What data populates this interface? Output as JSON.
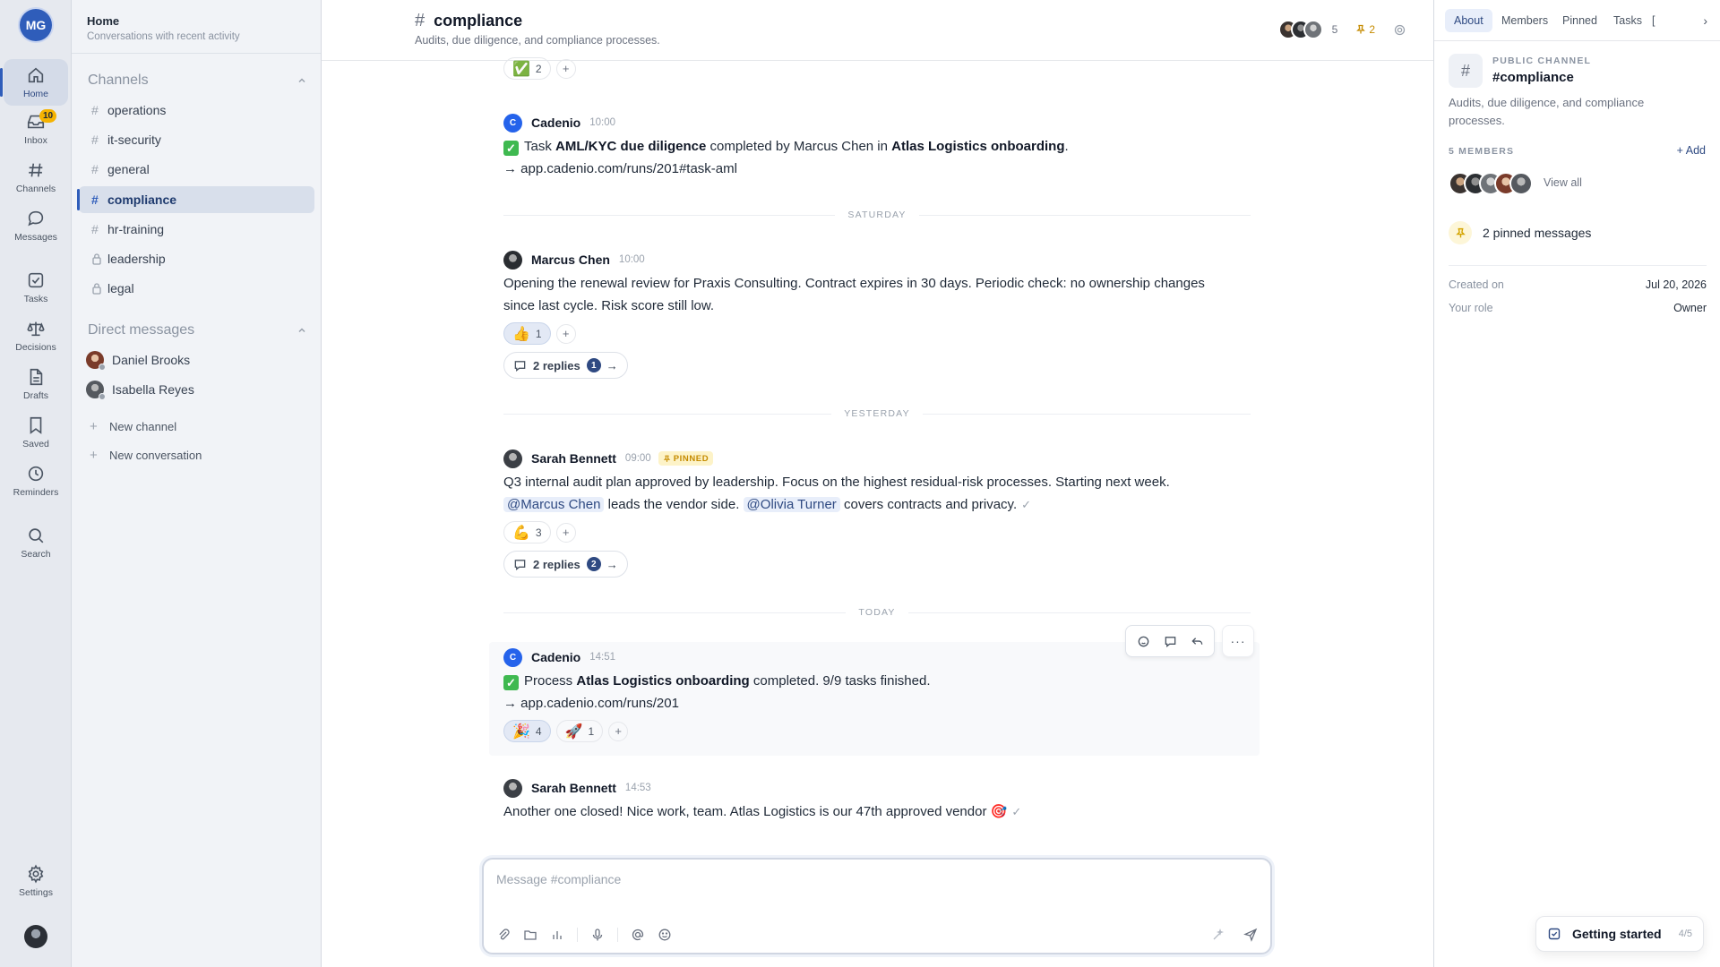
{
  "rail": {
    "user_initials": "MG",
    "items": [
      {
        "label": "Home"
      },
      {
        "label": "Inbox",
        "badge": "10"
      },
      {
        "label": "Channels"
      },
      {
        "label": "Messages"
      },
      {
        "label": "Tasks"
      },
      {
        "label": "Decisions"
      },
      {
        "label": "Drafts"
      },
      {
        "label": "Saved"
      },
      {
        "label": "Reminders"
      },
      {
        "label": "Search"
      },
      {
        "label": "Settings"
      }
    ]
  },
  "sidebar": {
    "title": "Home",
    "subtitle": "Conversations with recent activity",
    "channels_heading": "Channels",
    "channels": [
      {
        "name": "operations",
        "icon": "hash"
      },
      {
        "name": "it-security",
        "icon": "hash"
      },
      {
        "name": "general",
        "icon": "hash"
      },
      {
        "name": "compliance",
        "icon": "hash",
        "active": true
      },
      {
        "name": "hr-training",
        "icon": "hash"
      },
      {
        "name": "leadership",
        "icon": "lock"
      },
      {
        "name": "legal",
        "icon": "lock"
      }
    ],
    "dm_heading": "Direct messages",
    "dms": [
      {
        "name": "Daniel Brooks"
      },
      {
        "name": "Isabella Reyes"
      }
    ],
    "new_channel": "New channel",
    "new_conversation": "New conversation"
  },
  "channel": {
    "name": "compliance",
    "description": "Audits, due diligence, and compliance processes.",
    "member_count": "5",
    "pinned_count": "2"
  },
  "messages": [
    {
      "author": "Cadenio",
      "avatar_letter": "C",
      "time": "10:00",
      "line1": {
        "pre": "Task ",
        "b1": "AML/KYC due diligence",
        "mid": " completed by Marcus Chen in ",
        "b2": "Atlas Logistics onboarding",
        "post": "."
      },
      "line2": "→ app.cadenio.com/runs/201#task-aml"
    },
    {
      "author": "Marcus Chen",
      "time": "10:00",
      "text": "Opening the renewal review for Praxis Consulting. Contract expires in 30 days. Periodic check: no ownership changes since last cycle. Risk score still low.",
      "reaction": {
        "emoji": "👍",
        "count": "1"
      },
      "replies": {
        "label": "2 replies",
        "count": "1"
      }
    },
    {
      "author": "Sarah Bennett",
      "time": "09:00",
      "badge": "PINNED",
      "line1": "Q3 internal audit plan approved by leadership. Focus on the highest residual-risk processes. Starting next week.",
      "mention1": "@Marcus Chen",
      "mid": " leads the vendor side. ",
      "mention2": "@Olivia Turner",
      "post": " covers contracts and privacy.",
      "reaction": {
        "emoji": "💪",
        "count": "3"
      },
      "replies": {
        "label": "2 replies",
        "count": "2"
      }
    },
    {
      "author": "Cadenio",
      "avatar_letter": "C",
      "time": "14:51",
      "line1": {
        "pre": "Process ",
        "b1": "Atlas Logistics onboarding",
        "post": " completed. 9/9 tasks finished."
      },
      "line2": "→ app.cadenio.com/runs/201",
      "reactions": [
        {
          "emoji": "🎉",
          "count": "4"
        },
        {
          "emoji": "🚀",
          "count": "1"
        }
      ]
    },
    {
      "author": "Sarah Bennett",
      "time": "14:53",
      "text": "Another one closed! Nice work, team. Atlas Logistics is our 47th approved vendor 🎯"
    }
  ],
  "top_reaction": {
    "emoji": "✅",
    "count": "2"
  },
  "separators": {
    "saturday": "SATURDAY",
    "yesterday": "YESTERDAY",
    "today": "TODAY"
  },
  "composer": {
    "placeholder": "Message #compliance"
  },
  "right_panel": {
    "tabs": [
      "About",
      "Members",
      "Pinned",
      "Tasks",
      "["
    ],
    "kind": "PUBLIC CHANNEL",
    "name": "#compliance",
    "description": "Audits, due diligence, and compliance processes.",
    "members_heading": "5 MEMBERS",
    "add_label": "+ Add",
    "view_all": "View all",
    "pinned_messages": "2 pinned messages",
    "created_label": "Created on",
    "created_value": "Jul 20, 2026",
    "role_label": "Your role",
    "role_value": "Owner"
  },
  "getting_started": {
    "label": "Getting started",
    "progress": "4/5"
  },
  "colors": {
    "accent": "#2f5dba",
    "badge": "#f5b301",
    "bot": "#2563eb"
  }
}
